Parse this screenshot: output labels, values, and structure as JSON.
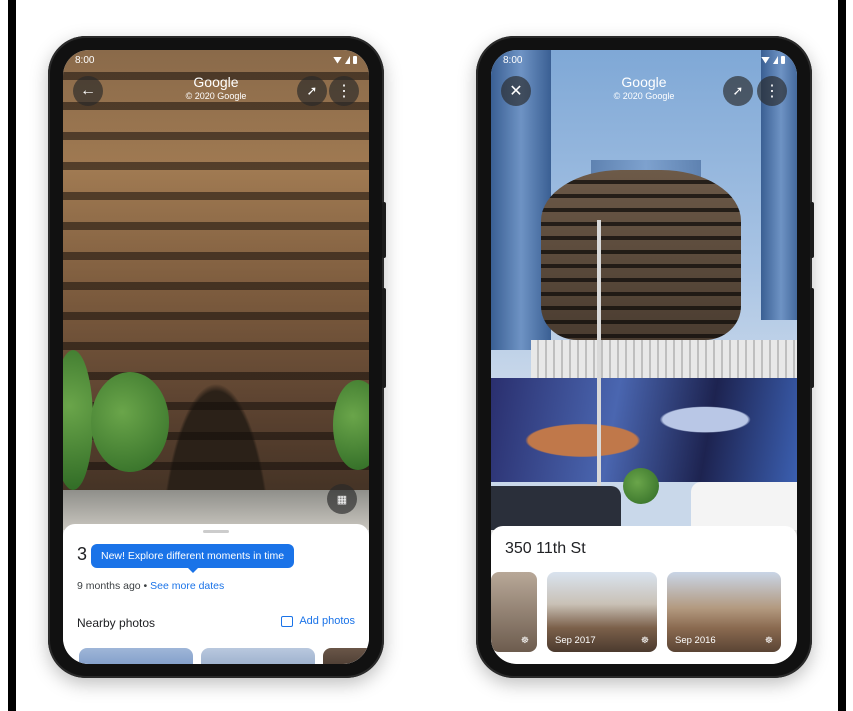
{
  "status_bar": {
    "time": "8:00"
  },
  "left_phone": {
    "title": "Google",
    "subtitle": "© 2020 Google",
    "back_icon": "arrow-left-icon",
    "compass_icon": "compass-icon",
    "more_icon": "more-vert-icon",
    "map_icon": "map-icon",
    "sheet_title_partial": "3",
    "tooltip": "New! Explore different moments in time",
    "date_text": "9 months ago • ",
    "date_link": "See more dates",
    "nearby_label": "Nearby photos",
    "add_photos_label": "Add photos",
    "add_photos_icon": "add-photo-icon",
    "accent": "#1a73e8"
  },
  "right_phone": {
    "title": "Google",
    "subtitle": "© 2020 Google",
    "close_icon": "close-icon",
    "compass_icon": "compass-icon",
    "more_icon": "more-vert-icon",
    "address": "350 11th St",
    "thumbnails": [
      {
        "label": ""
      },
      {
        "label": "Sep 2017"
      },
      {
        "label": "Sep 2016"
      }
    ]
  }
}
